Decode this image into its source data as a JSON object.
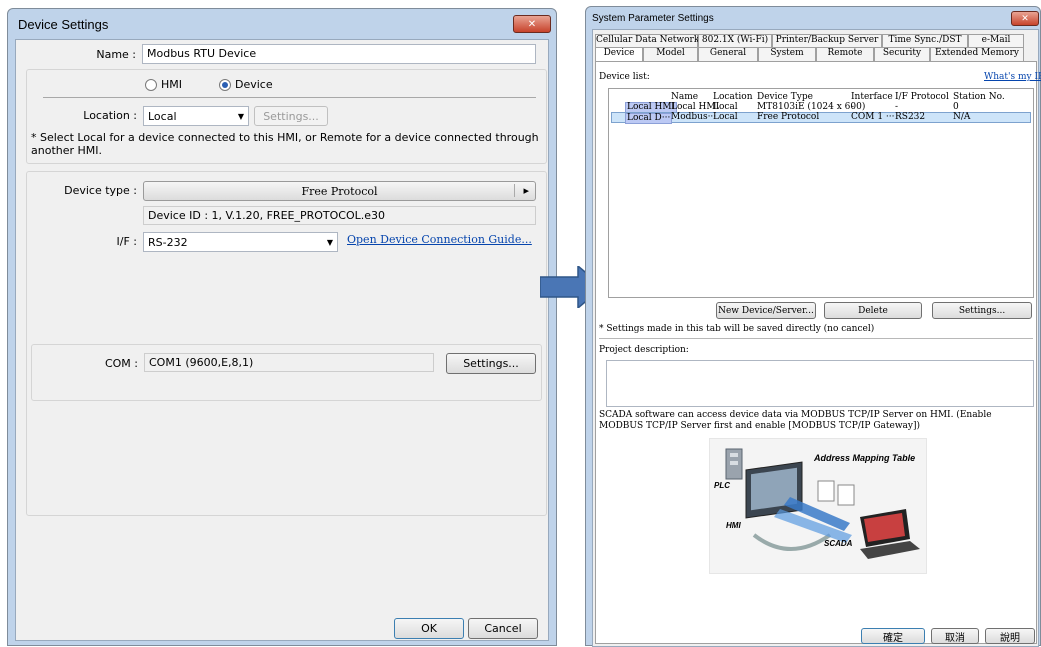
{
  "left_dialog": {
    "title": "Device Settings",
    "close_glyph": "✕",
    "name_label": "Name :",
    "name_value": "Modbus RTU Device",
    "radio_hmi": "HMI",
    "radio_device": "Device",
    "location_label": "Location :",
    "location_value": "Local",
    "location_settings": "Settings...",
    "location_note": "* Select Local for a device connected to this HMI, or Remote for a device connected through another HMI.",
    "device_type_label": "Device type :",
    "device_type_value": "Free Protocol",
    "device_type_arrow": "▸",
    "device_id": "Device ID : 1, V.1.20, FREE_PROTOCOL.e30",
    "if_label": "I/F :",
    "if_value": "RS-232",
    "guide_link": "Open Device Connection Guide...",
    "com_label": "COM :",
    "com_value": "COM1 (9600,E,8,1)",
    "com_settings": "Settings...",
    "ok": "OK",
    "cancel": "Cancel"
  },
  "arrow_color": "#4a76b5",
  "right_dialog": {
    "title": "System Parameter Settings",
    "close_glyph": "✕",
    "tabs_top": [
      "Cellular Data Network",
      "802.1X (Wi-Fi)",
      "Printer/Backup Server",
      "Time Sync./DST",
      "e-Mail"
    ],
    "tabs_bottom": [
      "Device",
      "Model",
      "General",
      "System",
      "Remote",
      "Security",
      "Extended Memory"
    ],
    "device_list_label": "Device list:",
    "whats_my_ip": "What's my IP?",
    "columns": [
      "Name",
      "Location",
      "Device Type",
      "Interface",
      "I/F Protocol",
      "Station No."
    ],
    "rows": [
      {
        "tag": "Local HMI",
        "name": "Local HMI",
        "location": "Local",
        "type": "MT8103iE (1024 x 600)",
        "interface": "-",
        "protocol": "-",
        "station": "0"
      },
      {
        "tag": "Local D···",
        "name": "Modbus···",
        "location": "Local",
        "type": "Free Protocol",
        "interface": "COM 1 ···",
        "protocol": "RS232",
        "station": "N/A"
      }
    ],
    "btn_new": "New Device/Server...",
    "btn_delete": "Delete",
    "btn_settings": "Settings...",
    "settings_note": "* Settings made in this tab will be saved directly (no cancel)",
    "project_desc_label": "Project description:",
    "scada_text": "SCADA software can access device data via MODBUS TCP/IP Server on HMI. (Enable MODBUS TCP/IP Server first and enable [MODBUS TCP/IP Gateway])",
    "diagram": {
      "title": "Address Mapping Table",
      "plc": "PLC",
      "hmi": "HMI",
      "scada": "SCADA"
    },
    "btn_ok": "確定",
    "btn_cancel": "取消",
    "btn_help": "說明"
  }
}
